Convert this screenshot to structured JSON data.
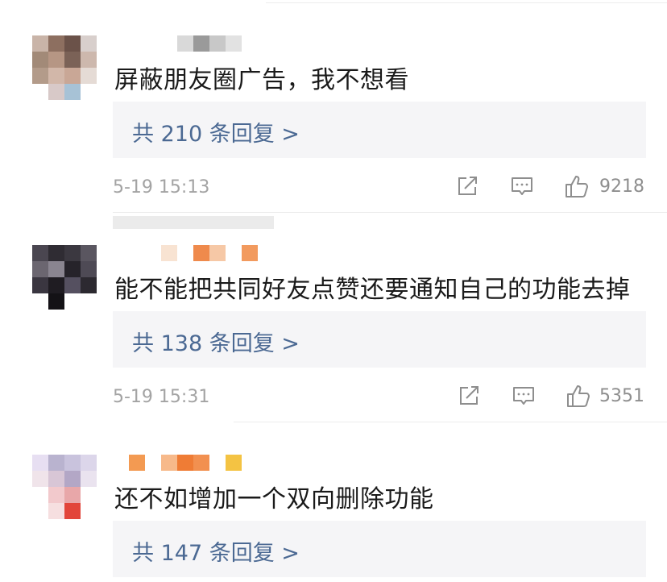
{
  "comments": [
    {
      "text": "屏蔽朋友圈广告，我不想看",
      "replies_label": "共 210 条回复 >",
      "time": "5-19 15:13",
      "likes": "9218"
    },
    {
      "text": "能不能把共同好友点赞还要通知自己的功能去掉",
      "replies_label": "共 138 条回复 >",
      "time": "5-19 15:31",
      "likes": "5351"
    },
    {
      "text": "还不如增加一个双向删除功能",
      "replies_label": "共 147 条回复 >"
    }
  ],
  "icons": {
    "share": "share-icon",
    "comment": "comment-icon",
    "like": "thumbs-up-icon"
  },
  "colors": {
    "reply_link": "#4b6993",
    "meta_text": "#a3a3a3",
    "reply_bg": "#f5f5f7"
  }
}
